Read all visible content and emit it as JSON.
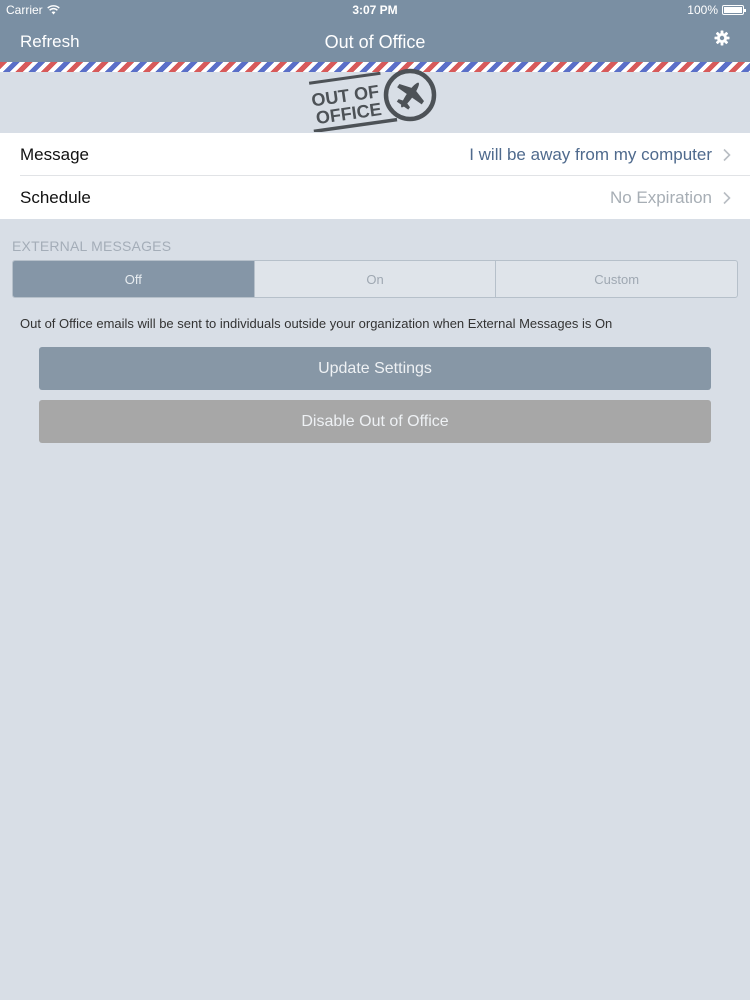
{
  "status_bar": {
    "carrier": "Carrier",
    "time": "3:07 PM",
    "battery": "100%"
  },
  "nav": {
    "left_button": "Refresh",
    "title": "Out of Office",
    "right_icon": "gear-icon"
  },
  "logo": {
    "line1": "OUT OF",
    "line2": "OFFICE",
    "icon": "airplane-icon"
  },
  "settings": {
    "message": {
      "label": "Message",
      "value": "I will be away from my computer"
    },
    "schedule": {
      "label": "Schedule",
      "value": "No Expiration"
    }
  },
  "external_messages": {
    "header": "EXTERNAL MESSAGES",
    "options": [
      "Off",
      "On",
      "Custom"
    ],
    "selected": "Off",
    "info": "Out of Office emails will be sent to individuals outside your organization when External Messages is On"
  },
  "buttons": {
    "update": "Update Settings",
    "disable": "Disable Out of Office"
  },
  "colors": {
    "nav_bar": "#7a8fa3",
    "background": "#d8dee6",
    "message_value": "#4f6a8d",
    "active_segment": "#8596a7",
    "update_button": "#8797a6",
    "disable_button": "#a7a7a7",
    "stripe_red": "#d75a5a",
    "stripe_blue": "#5a6fc8"
  }
}
